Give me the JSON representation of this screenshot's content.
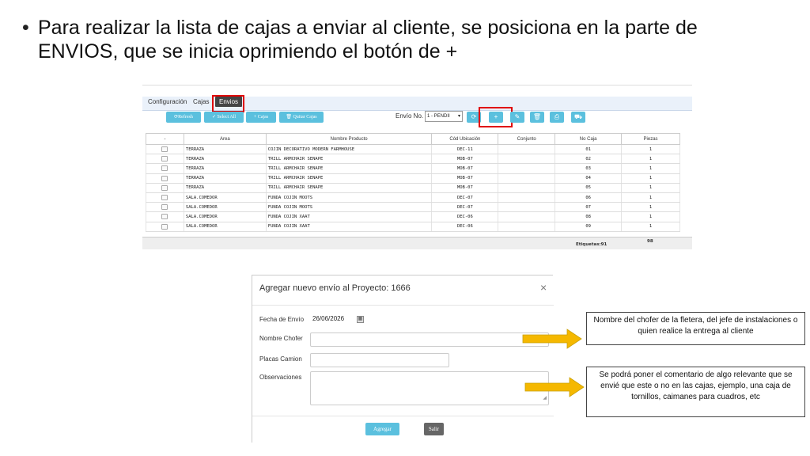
{
  "slide": {
    "bullet": "•",
    "line1": "Para realizar la lista de cajas a enviar al cliente, se posiciona en la parte de",
    "line2": "ENVIOS, que se inicia oprimiendo el botón de +"
  },
  "app": {
    "tabs": [
      "Configuración",
      "Cajas",
      "Envios"
    ],
    "active_tab": "Envios",
    "toolbar": {
      "refresh": "⟳Refresh",
      "select_all": "✓ Select All",
      "cajas": "+ Cajas",
      "quitar_cajas": "🗑 Quitar Cajas",
      "envio_label": "Envío No.",
      "envio_value": "1 - PENDII",
      "icons": [
        "refresh-icon",
        "plus-icon",
        "pencil-icon",
        "trash-icon",
        "print-icon",
        "truck-icon"
      ],
      "icon_glyphs": [
        "⟳",
        "+",
        "✎",
        "🗑",
        "⎙",
        "⛟"
      ]
    },
    "table": {
      "headers": [
        "-",
        "Area",
        "Nombre Producto",
        "Cód Ubicación",
        "Conjunto",
        "No Caja",
        "Piezas"
      ],
      "rows": [
        [
          "TERRAZA",
          "COJIN DECORATIVO MODERN FARMHOUSE",
          "DEC-11",
          "",
          "01",
          "1"
        ],
        [
          "TERRAZA",
          "TRILL ARMCHAIR SENAPE",
          "MOB-07",
          "",
          "02",
          "1"
        ],
        [
          "TERRAZA",
          "TRILL ARMCHAIR SENAPE",
          "MOB-07",
          "",
          "03",
          "1"
        ],
        [
          "TERRAZA",
          "TRILL ARMCHAIR SENAPE",
          "MOB-07",
          "",
          "04",
          "1"
        ],
        [
          "TERRAZA",
          "TRILL ARMCHAIR SENAPE",
          "MOB-07",
          "",
          "05",
          "1"
        ],
        [
          "SALA.COMEDOR",
          "FUNDA COJIN MOOTS",
          "DEC-07",
          "",
          "06",
          "1"
        ],
        [
          "SALA.COMEDOR",
          "FUNDA COJIN MOOTS",
          "DEC-07",
          "",
          "07",
          "1"
        ],
        [
          "SALA.COMEDOR",
          "FUNDA COJIN XAAT",
          "DEC-06",
          "",
          "08",
          "1"
        ],
        [
          "SALA.COMEDOR",
          "FUNDA COJIN XAAT",
          "DEC-06",
          "",
          "09",
          "1"
        ]
      ],
      "footer_etiquetas": "Etiquetas:91",
      "footer_piezas": "98"
    }
  },
  "modal": {
    "title": "Agregar nuevo envío al Proyecto: 1666",
    "close": "×",
    "fecha_label": "Fecha de Envío",
    "fecha_value": "26/06/2026",
    "chofer_label": "Nombre Chofer",
    "placas_label": "Placas Camion",
    "observaciones_label": "Observaciones",
    "agregar": "Agregar",
    "salir": "Salir"
  },
  "callouts": {
    "chofer_note": "Nombre  del chofer de la fletera, del jefe de instalaciones o quien realice la entrega al cliente",
    "obs_note": "Se podrá  poner el comentario  de algo relevante que se envié que este o no  en las cajas, ejemplo, una caja de tornillos, caimanes para cuadros, etc"
  },
  "colors": {
    "accent": "#5bc0de",
    "highlight": "#e00000",
    "arrow": "#f5b800"
  }
}
